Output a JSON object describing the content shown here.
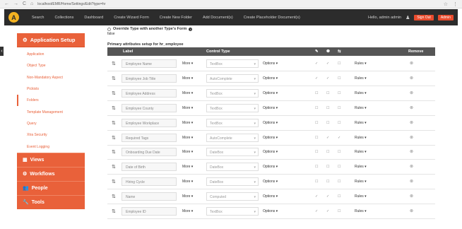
{
  "browser": {
    "nav_icons": [
      "←",
      "→",
      "C",
      "⌂"
    ],
    "url": "localhost/EMR/Home/Settings/Edit?type=hr",
    "right_icons": [
      "☆",
      "⋮"
    ]
  },
  "topbar": {
    "logo_text": "A",
    "nav": [
      "Search",
      "Collections",
      "Dashboard",
      "Create Wizard Form",
      "Create New Folder",
      "Add Document(s)",
      "Create Placeholder Document(s)"
    ],
    "greeting": "Hello, admin admin",
    "user_icon": "user-icon",
    "btn_signout": "Sign Out",
    "btn_admin": "Admin"
  },
  "sidebar": {
    "collapse_icon": "‹",
    "app_setup": "Application Setup",
    "app_setup_icon": "gear-icon",
    "sub_items": [
      "Application",
      "Object Type",
      "Non-Mandatory Aspect",
      "Pickists",
      "Folders",
      "Template Management",
      "Query",
      "Xtra Security",
      "Event Logging"
    ],
    "active_index": 4,
    "sections": [
      {
        "label": "Views",
        "icon": "views-icon",
        "glyph": "▦"
      },
      {
        "label": "Workflows",
        "icon": "workflow-icon",
        "glyph": "⚙"
      },
      {
        "label": "People",
        "icon": "people-icon",
        "glyph": "👥"
      },
      {
        "label": "Tools",
        "icon": "tools-icon",
        "glyph": "🔧"
      }
    ]
  },
  "main": {
    "override_label": "Override Type with another Type's Form",
    "override_value": "false",
    "primary_title": "Primary attributes setup for hr_employee",
    "headers": {
      "label": "Label",
      "control_type": "Control Type",
      "remove": "Remove",
      "icon_edit": "✎",
      "icon_info": "❶",
      "icon_link": "⇆"
    },
    "more_label": "More ▾",
    "options_label": "Options ▾",
    "rules_label": "Rules ▾",
    "remove_glyph": "⊗",
    "drag_glyph": "⇅",
    "caret": "▾",
    "rows": [
      {
        "label": "Employee Name",
        "control": "TextBox",
        "c1": "✓",
        "c2": "✓",
        "c3": "☐"
      },
      {
        "label": "Employee Job Title",
        "control": "AutoComplete",
        "c1": "✓",
        "c2": "✓",
        "c3": "☐"
      },
      {
        "label": "Employee Address",
        "control": "TextBox",
        "c1": "☐",
        "c2": "☐",
        "c3": "☐"
      },
      {
        "label": "Employee County",
        "control": "TextBox",
        "c1": "☐",
        "c2": "☐",
        "c3": "☐"
      },
      {
        "label": "Employee Workplace",
        "control": "TextBox",
        "c1": "☐",
        "c2": "☐",
        "c3": "☐"
      },
      {
        "label": "Required Tags",
        "control": "AutoComplete",
        "c1": "☐",
        "c2": "✓",
        "c3": "✓"
      },
      {
        "label": "Onboarding Due Date",
        "control": "DateBox",
        "c1": "☐",
        "c2": "☐",
        "c3": "☐"
      },
      {
        "label": "Date of Birth",
        "control": "DateBox",
        "c1": "☐",
        "c2": "☐",
        "c3": "☐"
      },
      {
        "label": "Hiring Cycle",
        "control": "DateBox",
        "c1": "☐",
        "c2": "☐",
        "c3": "☐"
      },
      {
        "label": "Name",
        "control": "Computed",
        "c1": "✓",
        "c2": "✓",
        "c3": "☐"
      },
      {
        "label": "Employee ID",
        "control": "TextBox",
        "c1": "✓",
        "c2": "✓",
        "c3": "☐"
      }
    ]
  },
  "colors": {
    "accent": "#e9613a",
    "topbar": "#2c2c2c",
    "table_header": "#555555"
  }
}
